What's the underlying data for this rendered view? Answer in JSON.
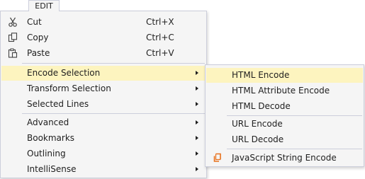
{
  "top_menu": {
    "label": "EDIT"
  },
  "edit_menu": {
    "items": [
      {
        "label": "Cut",
        "shortcut": "Ctrl+X",
        "icon": "scissors-icon"
      },
      {
        "label": "Copy",
        "shortcut": "Ctrl+C",
        "icon": "copy-icon"
      },
      {
        "label": "Paste",
        "shortcut": "Ctrl+V",
        "icon": "paste-icon"
      },
      {
        "label": "Encode Selection",
        "has_submenu": true,
        "highlighted": true
      },
      {
        "label": "Transform Selection",
        "has_submenu": true
      },
      {
        "label": "Selected Lines",
        "has_submenu": true
      },
      {
        "label": "Advanced",
        "has_submenu": true
      },
      {
        "label": "Bookmarks",
        "has_submenu": true
      },
      {
        "label": "Outlining",
        "has_submenu": true
      },
      {
        "label": "IntelliSense",
        "has_submenu": true
      }
    ]
  },
  "encode_submenu": {
    "items": [
      {
        "label": "HTML Encode",
        "highlighted": true
      },
      {
        "label": "HTML Attribute Encode"
      },
      {
        "label": "HTML Decode"
      },
      {
        "label": "URL Encode"
      },
      {
        "label": "URL Decode"
      },
      {
        "label": "JavaScript String Encode",
        "icon": "javascript-encode-icon"
      }
    ]
  },
  "colors": {
    "menu_background": "#f5f5f5",
    "menu_border": "#cccedb",
    "highlight": "#fdf4bf",
    "text": "#1e1e1e",
    "js_icon_accent": "#e8711c"
  }
}
